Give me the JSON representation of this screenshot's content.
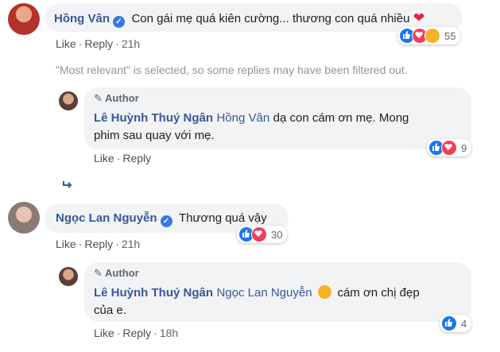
{
  "comments": [
    {
      "name": "Hồng Vân",
      "text": "Con gái mẹ quá kiên cường... thương con quá nhiều",
      "like_label": "Like",
      "reply_label": "Reply",
      "time": "21h",
      "reaction_count": "55"
    },
    {
      "author_tag": "Author",
      "name": "Lê Huỳnh Thuý Ngân",
      "mention": "Hồng Vân",
      "text_line1": "dạ con cám ơn mẹ. Mong",
      "text_line2": "phim sau quay với mẹ.",
      "like_label": "Like",
      "reply_label": "Reply",
      "reaction_count": "9"
    },
    {
      "name": "Ngọc Lan Nguyễn",
      "text": "Thương quá vậy",
      "like_label": "Like",
      "reply_label": "Reply",
      "time": "21h",
      "reaction_count": "30"
    },
    {
      "author_tag": "Author",
      "name": "Lê Huỳnh Thuý Ngân",
      "mention": "Ngọc Lan Nguyễn",
      "text_line1": "cám ơn chị đẹp",
      "text_line2": "của e.",
      "like_label": "Like",
      "reply_label": "Reply",
      "time": "18h",
      "reaction_count": "4"
    }
  ],
  "filter_note": "\"Most relevant\" is selected, so some replies may have been filtered out.",
  "colors": {
    "link": "#385898",
    "like": "#1877f2",
    "love": "#f33e58",
    "bubble": "#f2f3f5"
  }
}
